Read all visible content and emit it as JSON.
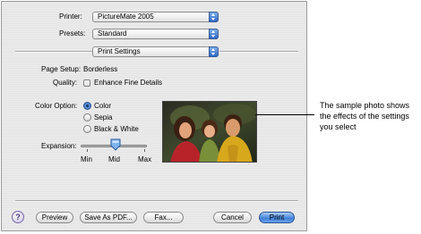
{
  "printer": {
    "label": "Printer:",
    "value": "PictureMate 2005"
  },
  "presets": {
    "label": "Presets:",
    "value": "Standard"
  },
  "panel": {
    "value": "Print Settings"
  },
  "page_setup": {
    "label": "Page Setup:",
    "value": "Borderless"
  },
  "quality": {
    "label": "Quality:",
    "checkbox_label": "Enhance Fine Details",
    "checked": false
  },
  "color_option": {
    "label": "Color Option:",
    "options": [
      {
        "label": "Color",
        "selected": true
      },
      {
        "label": "Sepia",
        "selected": false
      },
      {
        "label": "Black & White",
        "selected": false
      }
    ]
  },
  "expansion": {
    "label": "Expansion:",
    "ticks": [
      "Min",
      "Mid",
      "Max"
    ],
    "value": "Mid"
  },
  "buttons": {
    "help": "?",
    "preview": "Preview",
    "save_pdf": "Save As PDF...",
    "fax": "Fax...",
    "cancel": "Cancel",
    "print": "Print"
  },
  "callout": {
    "text": "The sample photo shows the effects of the settings you select"
  },
  "colors": {
    "accent": "#3f80d8",
    "dialog_bg": "#e8e8e8"
  }
}
